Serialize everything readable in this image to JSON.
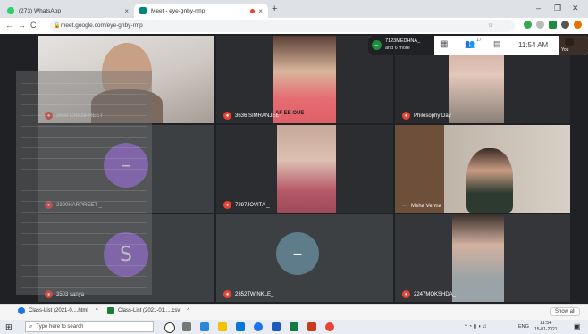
{
  "tabs": [
    {
      "label": "(273) WhatsApp",
      "close": "×"
    },
    {
      "label": "Meet - eye-gnby-rmp",
      "close": "×"
    }
  ],
  "new_tab": "+",
  "window_controls": {
    "minimize": "–",
    "maximize": "❐",
    "close": "✕"
  },
  "address": {
    "url": "meet.google.com/eye-gnby-rmp"
  },
  "nav": {
    "back": "←",
    "forward": "→",
    "reload": "C"
  },
  "meet": {
    "tiles": [
      {
        "name": "3630 CHANPREET"
      },
      {
        "name": "3636 SIMRANJEET"
      },
      {
        "name": "Philosophy Day"
      },
      {
        "name": "2390HARPREET _"
      },
      {
        "name": "7297JOVITA _"
      },
      {
        "name": "Meha Verma",
        "more": "⋯"
      },
      {
        "name": "3503 sanya",
        "avatar_letter": "S"
      },
      {
        "name": "2352TWINKLE_"
      },
      {
        "name": "2247MOKSHDA_"
      }
    ],
    "top_bar": {
      "presenter_line1": "7123MEDHNA_",
      "presenter_line2": "and 6 more",
      "people_count": "17",
      "time": "11:54 AM",
      "self_label": "You"
    },
    "shirt_text": "AF EE OUE"
  },
  "downloads": [
    {
      "label": "Class-List (2021-0....html",
      "caret": "^"
    },
    {
      "label": "Class-List (2021-01.....csv",
      "caret": "^"
    }
  ],
  "downloads_show_all": "Show all",
  "taskbar": {
    "search_placeholder": "Type here to search",
    "time": "11:54",
    "date": "15-01-2021",
    "lang": "ENG"
  }
}
